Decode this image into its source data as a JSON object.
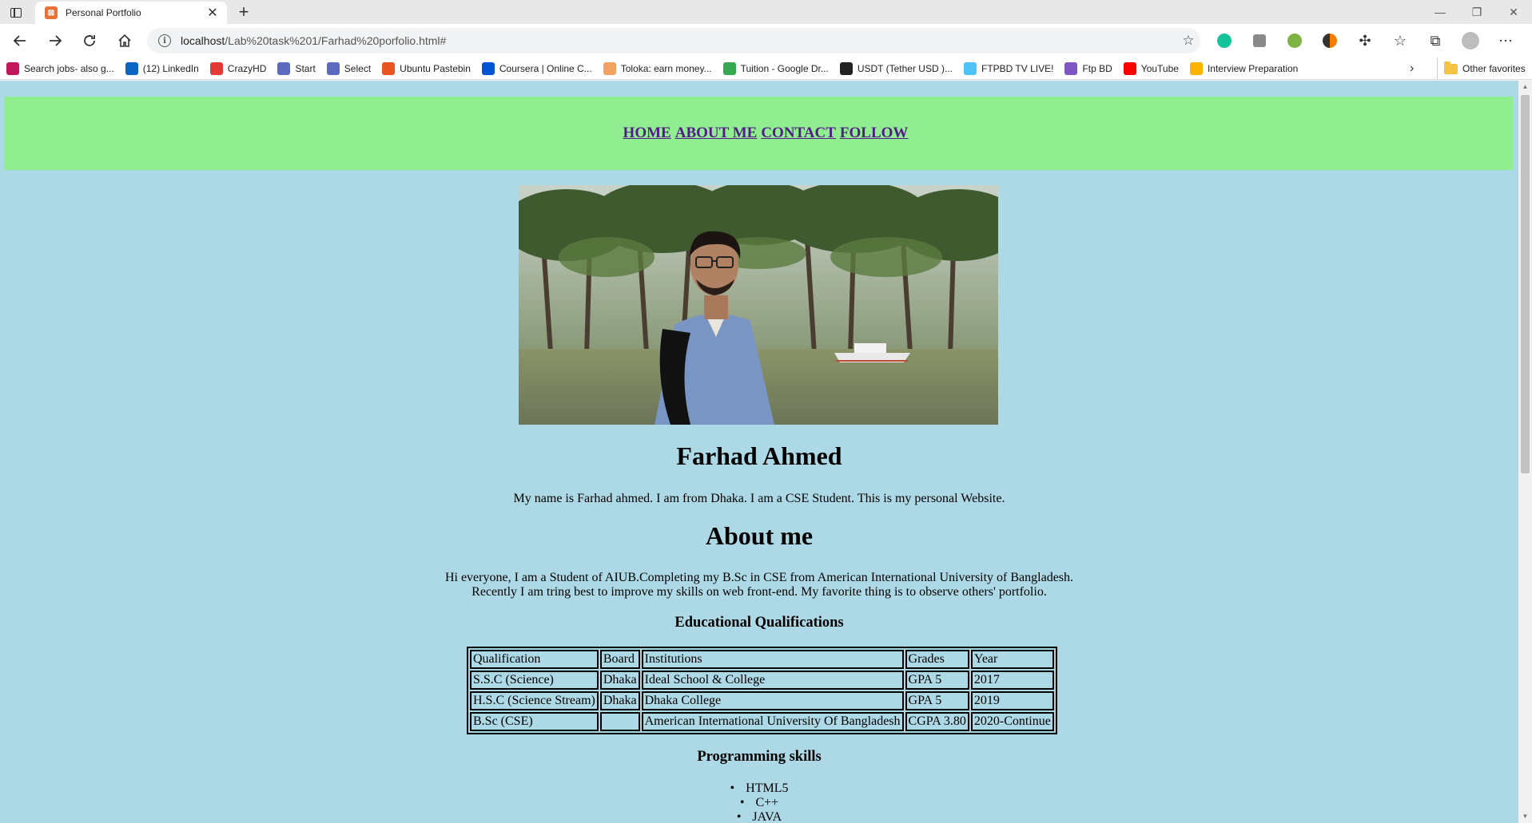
{
  "browser": {
    "tab_title": "Personal Portfolio",
    "tab_favicon_text": "⊠",
    "url_host": "localhost",
    "url_path": "/Lab%20task%201/Farhad%20porfolio.html#",
    "bookmarks": [
      {
        "label": "Search jobs- also g...",
        "color": "#c2185b"
      },
      {
        "label": "(12) LinkedIn",
        "color": "#0a66c2"
      },
      {
        "label": "CrazyHD",
        "color": "#e53935"
      },
      {
        "label": "Start",
        "color": "#5c6bc0"
      },
      {
        "label": "Select",
        "color": "#5c6bc0"
      },
      {
        "label": "Ubuntu Pastebin",
        "color": "#e95420"
      },
      {
        "label": "Coursera | Online C...",
        "color": "#0056d2"
      },
      {
        "label": "Toloka: earn money...",
        "color": "#f4a261"
      },
      {
        "label": "Tuition - Google Dr...",
        "color": "#34a853"
      },
      {
        "label": "USDT (Tether USD )...",
        "color": "#222222"
      },
      {
        "label": "FTPBD TV LIVE!",
        "color": "#4fc3f7"
      },
      {
        "label": "Ftp BD",
        "color": "#7e57c2"
      },
      {
        "label": "YouTube",
        "color": "#ff0000"
      },
      {
        "label": "Interview Preparation",
        "color": "#ffb300"
      }
    ],
    "other_favorites": "Other favorites"
  },
  "site": {
    "nav": [
      "HOME",
      "ABOUT ME",
      "CONTACT",
      "FOLLOW"
    ],
    "name": "Farhad Ahmed",
    "intro": "My name is Farhad ahmed. I am from Dhaka. I am a CSE Student. This is my personal Website.",
    "about_heading": "About me",
    "about_line1": "Hi everyone, I am a Student of AIUB.Completing my B.Sc in CSE from American International University of Bangladesh.",
    "about_line2": "Recently I am tring best to improve my skills on web front-end. My favorite thing is to observe others' portfolio.",
    "edu_heading": "Educational Qualifications",
    "edu_table": {
      "header": [
        "Qualification",
        "Board",
        "Institutions",
        "Grades",
        "Year"
      ],
      "rows": [
        [
          "S.S.C (Science)",
          "Dhaka",
          "Ideal School & College",
          "GPA 5",
          "2017"
        ],
        [
          "H.S.C (Science Stream)",
          "Dhaka",
          "Dhaka College",
          "GPA 5",
          "2019"
        ],
        [
          "B.Sc (CSE)",
          "",
          "American International University Of Bangladesh",
          "CGPA 3.80",
          "2020-Continue"
        ]
      ]
    },
    "skills_heading": "Programming skills",
    "skills": [
      "HTML5",
      "C++",
      "JAVA"
    ]
  },
  "colors": {
    "page_bg": "#add8e6",
    "nav_bg": "#90ee90",
    "link": "#551a8b"
  }
}
